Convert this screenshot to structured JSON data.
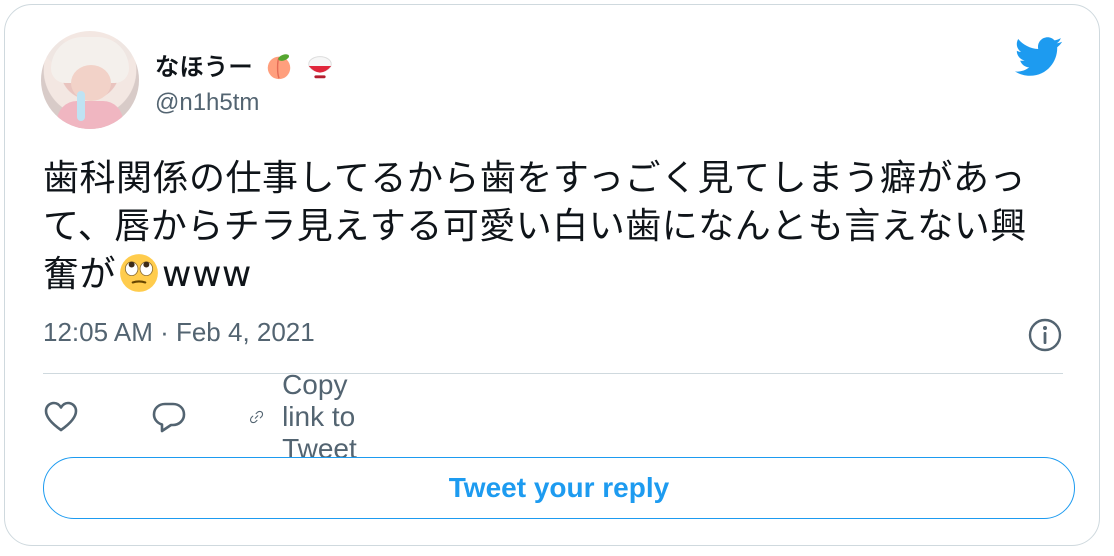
{
  "user": {
    "display_name": "なほうー",
    "name_emojis": [
      "peach-emoji",
      "rice-bowl-emoji"
    ],
    "handle": "@n1h5tm"
  },
  "tweet": {
    "text_before_emoji": "歯科関係の仕事してるから歯をすっごく見てしまう癖があって、唇からチラ見えする可愛い白い歯になんとも言えない興奮が",
    "emoji": "face-with-rolling-eyes-emoji",
    "text_after_emoji": "www",
    "timestamp": "12:05 AM · Feb 4, 2021"
  },
  "actions": {
    "copy_link_label": "Copy link to Tweet"
  },
  "reply_button": {
    "label": "Tweet your reply"
  },
  "icons": {
    "brand": "twitter-bird-icon",
    "info": "info-icon",
    "like": "heart-icon",
    "reply": "reply-bubble-icon",
    "link": "link-icon"
  },
  "colors": {
    "brand_blue": "#1d9bf0",
    "text_primary": "#0f1419",
    "text_secondary": "#536471",
    "border": "#cfd9de"
  }
}
